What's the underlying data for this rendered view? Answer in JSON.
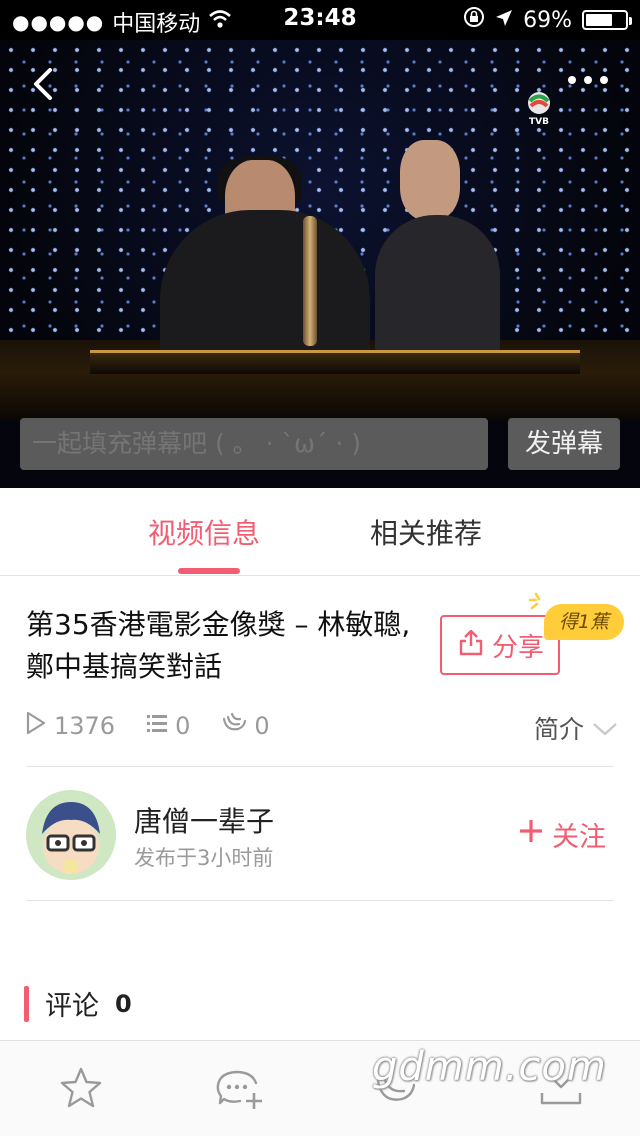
{
  "status_bar": {
    "signal_dots": "●●●●●",
    "carrier": "中国移动",
    "time": "23:48",
    "battery_percent": "69%",
    "battery_level": 0.69
  },
  "video": {
    "channel_logo_text": "TVB",
    "danmaku_placeholder": "一起填充弹幕吧 ( 。 · `ω´ · )",
    "danmaku_button": "发弹幕"
  },
  "tabs": [
    {
      "label": "视频信息",
      "active": true
    },
    {
      "label": "相关推荐",
      "active": false
    }
  ],
  "detail": {
    "title": "第35香港電影金像獎 – 林敏聰, 鄭中基搞笑對話",
    "share_label": "分享",
    "badge": "得1蕉",
    "views": "1376",
    "danmaku_count": "0",
    "banana_count": "0",
    "intro_label": "简介"
  },
  "uploader": {
    "name": "唐僧一辈子",
    "time": "发布于3小时前",
    "follow_label": "关注"
  },
  "comments": {
    "label": "评论",
    "count": "0"
  },
  "watermark": "gdmm.com",
  "colors": {
    "accent": "#f25d72",
    "badge": "#ffcc3a",
    "muted": "#9a9a9a"
  }
}
